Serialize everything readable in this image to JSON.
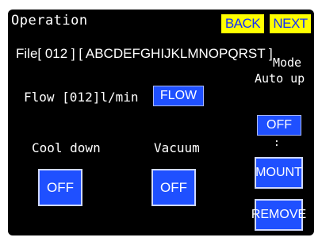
{
  "header": {
    "title": "Operation",
    "back_label": "BACK",
    "next_label": "NEXT"
  },
  "file": {
    "line": "File[ 012 ] [ ABCDEFGHIJKLMNOPQRST ]"
  },
  "flow": {
    "label": "Flow [012]l/min",
    "button_label": "FLOW"
  },
  "mode": {
    "label": "Mode",
    "sub_label": "Auto up",
    "button_label": "OFF",
    "separator": ":",
    "mount_label": "MOUNT",
    "remove_label": "REMOVE"
  },
  "cool_down": {
    "label": "Cool down",
    "button_label": "OFF"
  },
  "vacuum": {
    "label": "Vacuum",
    "button_label": "OFF"
  },
  "colors": {
    "panel_bg": "#000000",
    "button_blue": "#1f50ff",
    "nav_yellow": "#ffff00",
    "nav_text_blue": "#1030ff",
    "text": "#ffffff"
  }
}
